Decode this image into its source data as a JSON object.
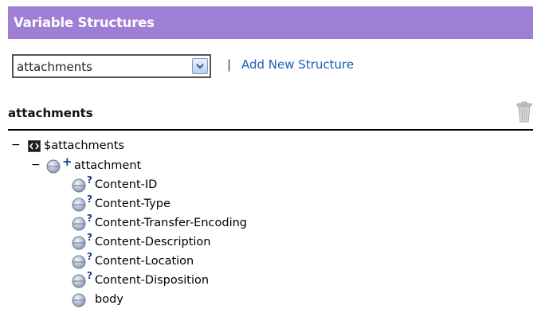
{
  "header": {
    "title": "Variable Structures"
  },
  "structure_select": {
    "value": "attachments"
  },
  "toolbar": {
    "separator": "|",
    "add_label": "Add New Structure"
  },
  "section": {
    "title": "attachments"
  },
  "tree": {
    "root": {
      "toggle": "−",
      "label": "$attachments"
    },
    "child": {
      "toggle": "−",
      "marker": "+",
      "label": "attachment"
    },
    "items": [
      {
        "label": "Content-ID",
        "marker": "?"
      },
      {
        "label": "Content-Type",
        "marker": "?"
      },
      {
        "label": "Content-Transfer-Encoding",
        "marker": "?"
      },
      {
        "label": "Content-Description",
        "marker": "?"
      },
      {
        "label": "Content-Location",
        "marker": "?"
      },
      {
        "label": "Content-Disposition",
        "marker": "?"
      },
      {
        "label": "body",
        "marker": ""
      }
    ]
  }
}
